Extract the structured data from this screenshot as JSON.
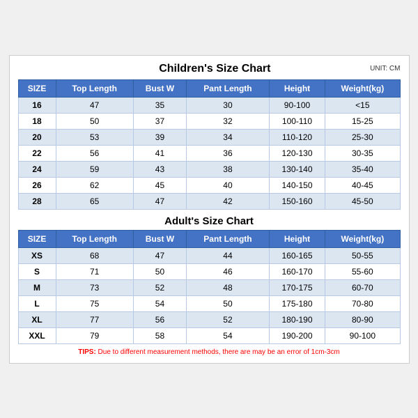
{
  "main_title": "Children's Size Chart",
  "unit": "UNIT: CM",
  "children": {
    "headers": [
      "SIZE",
      "Top Length",
      "Bust W",
      "Pant Length",
      "Height",
      "Weight(kg)"
    ],
    "rows": [
      [
        "16",
        "47",
        "35",
        "30",
        "90-100",
        "<15"
      ],
      [
        "18",
        "50",
        "37",
        "32",
        "100-110",
        "15-25"
      ],
      [
        "20",
        "53",
        "39",
        "34",
        "110-120",
        "25-30"
      ],
      [
        "22",
        "56",
        "41",
        "36",
        "120-130",
        "30-35"
      ],
      [
        "24",
        "59",
        "43",
        "38",
        "130-140",
        "35-40"
      ],
      [
        "26",
        "62",
        "45",
        "40",
        "140-150",
        "40-45"
      ],
      [
        "28",
        "65",
        "47",
        "42",
        "150-160",
        "45-50"
      ]
    ]
  },
  "adult_title": "Adult's Size Chart",
  "adult": {
    "headers": [
      "SIZE",
      "Top Length",
      "Bust W",
      "Pant Length",
      "Height",
      "Weight(kg)"
    ],
    "rows": [
      [
        "XS",
        "68",
        "47",
        "44",
        "160-165",
        "50-55"
      ],
      [
        "S",
        "71",
        "50",
        "46",
        "160-170",
        "55-60"
      ],
      [
        "M",
        "73",
        "52",
        "48",
        "170-175",
        "60-70"
      ],
      [
        "L",
        "75",
        "54",
        "50",
        "175-180",
        "70-80"
      ],
      [
        "XL",
        "77",
        "56",
        "52",
        "180-190",
        "80-90"
      ],
      [
        "XXL",
        "79",
        "58",
        "54",
        "190-200",
        "90-100"
      ]
    ]
  },
  "tips": "TIPS: Due to different measurement methods, there are may be an error of 1cm-3cm"
}
